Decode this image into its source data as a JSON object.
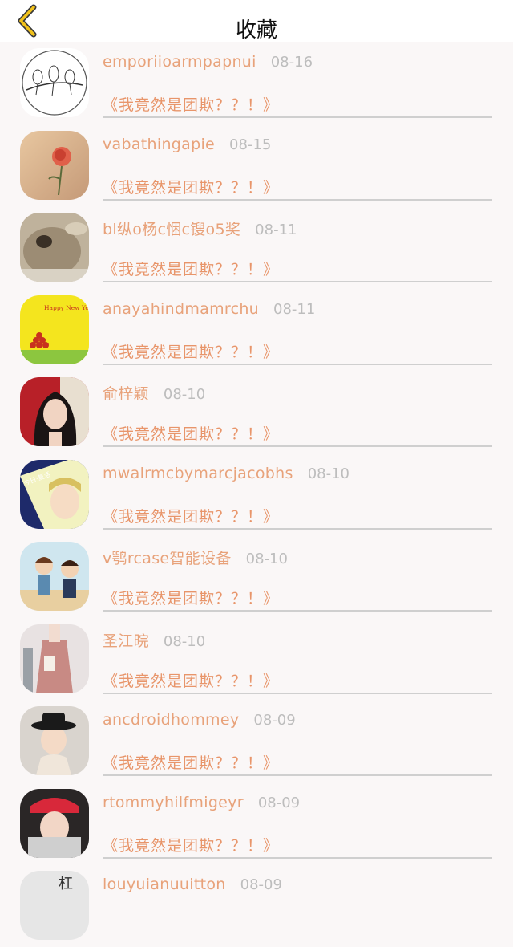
{
  "header": {
    "title": "收藏",
    "back_icon": "chevron-left-icon",
    "accent_color": "#e8b400"
  },
  "favorites": [
    {
      "username": "emporiioarmpapnui",
      "date": "08-16",
      "message": "《我竟然是团欺？？！》",
      "avatar": "birds-sketch"
    },
    {
      "username": "vabathingapie",
      "date": "08-15",
      "message": "《我竟然是团欺？？！》",
      "avatar": "rose"
    },
    {
      "username": "bl纵o杨c悃c锼o5奖",
      "date": "08-11",
      "message": "《我竟然是团欺？？！》",
      "avatar": "rabbit"
    },
    {
      "username": "anayahindmamrchu",
      "date": "08-11",
      "message": "《我竟然是团欺？？！》",
      "avatar": "new-year-card",
      "avatar_text": "Happy New Year"
    },
    {
      "username": "俞梓颖",
      "date": "08-10",
      "message": "《我竟然是团欺？？！》",
      "avatar": "girl-portrait"
    },
    {
      "username": "mwalrmcbymarcjacobhs",
      "date": "08-10",
      "message": "《我竟然是团欺？？！》",
      "avatar": "anime-selfie"
    },
    {
      "username": "v鹗rcase智能设备",
      "date": "08-10",
      "message": "《我竟然是团欺？？！》",
      "avatar": "cartoon-boys"
    },
    {
      "username": "圣江晥",
      "date": "08-10",
      "message": "《我竟然是团欺？？！》",
      "avatar": "pink-dress"
    },
    {
      "username": "ancdroidhommey",
      "date": "08-09",
      "message": "《我竟然是团欺？？！》",
      "avatar": "hat-girl"
    },
    {
      "username": "rtommyhilfmigeyr",
      "date": "08-09",
      "message": "《我竟然是团欺？？！》",
      "avatar": "red-cap"
    },
    {
      "username": "louyuianuuitton",
      "date": "08-09",
      "message": "",
      "avatar": "partial"
    }
  ]
}
